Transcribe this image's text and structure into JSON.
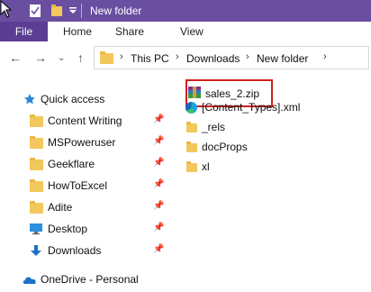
{
  "window": {
    "title": "New folder"
  },
  "ribbon": {
    "tabs": [
      {
        "label": "File"
      },
      {
        "label": "Home"
      },
      {
        "label": "Share"
      },
      {
        "label": "View"
      }
    ]
  },
  "nav": {
    "breadcrumbs": [
      "This PC",
      "Downloads",
      "New folder"
    ]
  },
  "sidebar": {
    "quick_access": "Quick access",
    "items": [
      {
        "label": "Content Writing",
        "icon": "folder-icon",
        "pinned": true
      },
      {
        "label": "MSPoweruser",
        "icon": "folder-icon",
        "pinned": true
      },
      {
        "label": "Geekflare",
        "icon": "folder-icon",
        "pinned": true
      },
      {
        "label": "HowToExcel",
        "icon": "folder-icon",
        "pinned": true
      },
      {
        "label": "Adite",
        "icon": "folder-icon",
        "pinned": true
      },
      {
        "label": "Desktop",
        "icon": "desktop-icon",
        "pinned": true
      },
      {
        "label": "Downloads",
        "icon": "downloads-icon",
        "pinned": true
      }
    ],
    "onedrive": "OneDrive - Personal"
  },
  "files": [
    {
      "name": "sales_2.zip",
      "icon": "zip-archive-icon",
      "highlighted": true
    },
    {
      "name": "[Content_Types].xml",
      "icon": "edge-xml-icon"
    },
    {
      "name": "_rels",
      "icon": "folder-icon"
    },
    {
      "name": "docProps",
      "icon": "folder-icon"
    },
    {
      "name": "xl",
      "icon": "folder-icon"
    }
  ],
  "colors": {
    "titlebar": "#6a4fa0",
    "file_tab": "#5b3d93",
    "highlight_box": "#d0201f",
    "folder": "#f2c75c"
  }
}
